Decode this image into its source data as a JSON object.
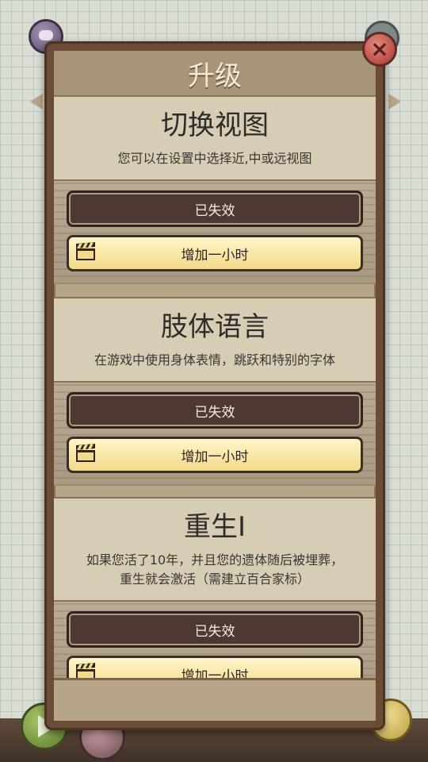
{
  "panel": {
    "title": "升级",
    "close_icon": "close-icon"
  },
  "upgrades": [
    {
      "title": "切换视图",
      "description": "您可以在设置中选择近,中或远视图",
      "status_label": "已失效",
      "extend_label": "增加一小时"
    },
    {
      "title": "肢体语言",
      "description": "在游戏中使用身体表情，跳跃和特别的字体",
      "status_label": "已失效",
      "extend_label": "增加一小时"
    },
    {
      "title": "重生I",
      "description_line1": "如果您活了10年，并且您的遗体随后被埋葬，",
      "description_line2": "重生就会激活（需建立百合家标）",
      "status_label": "已失效",
      "extend_label": "增加一小时"
    }
  ],
  "colors": {
    "panel_frame": "#6b4d37",
    "expired_button": "#4d3834",
    "add_button": "#f3d98a",
    "close_button": "#c0463b"
  }
}
